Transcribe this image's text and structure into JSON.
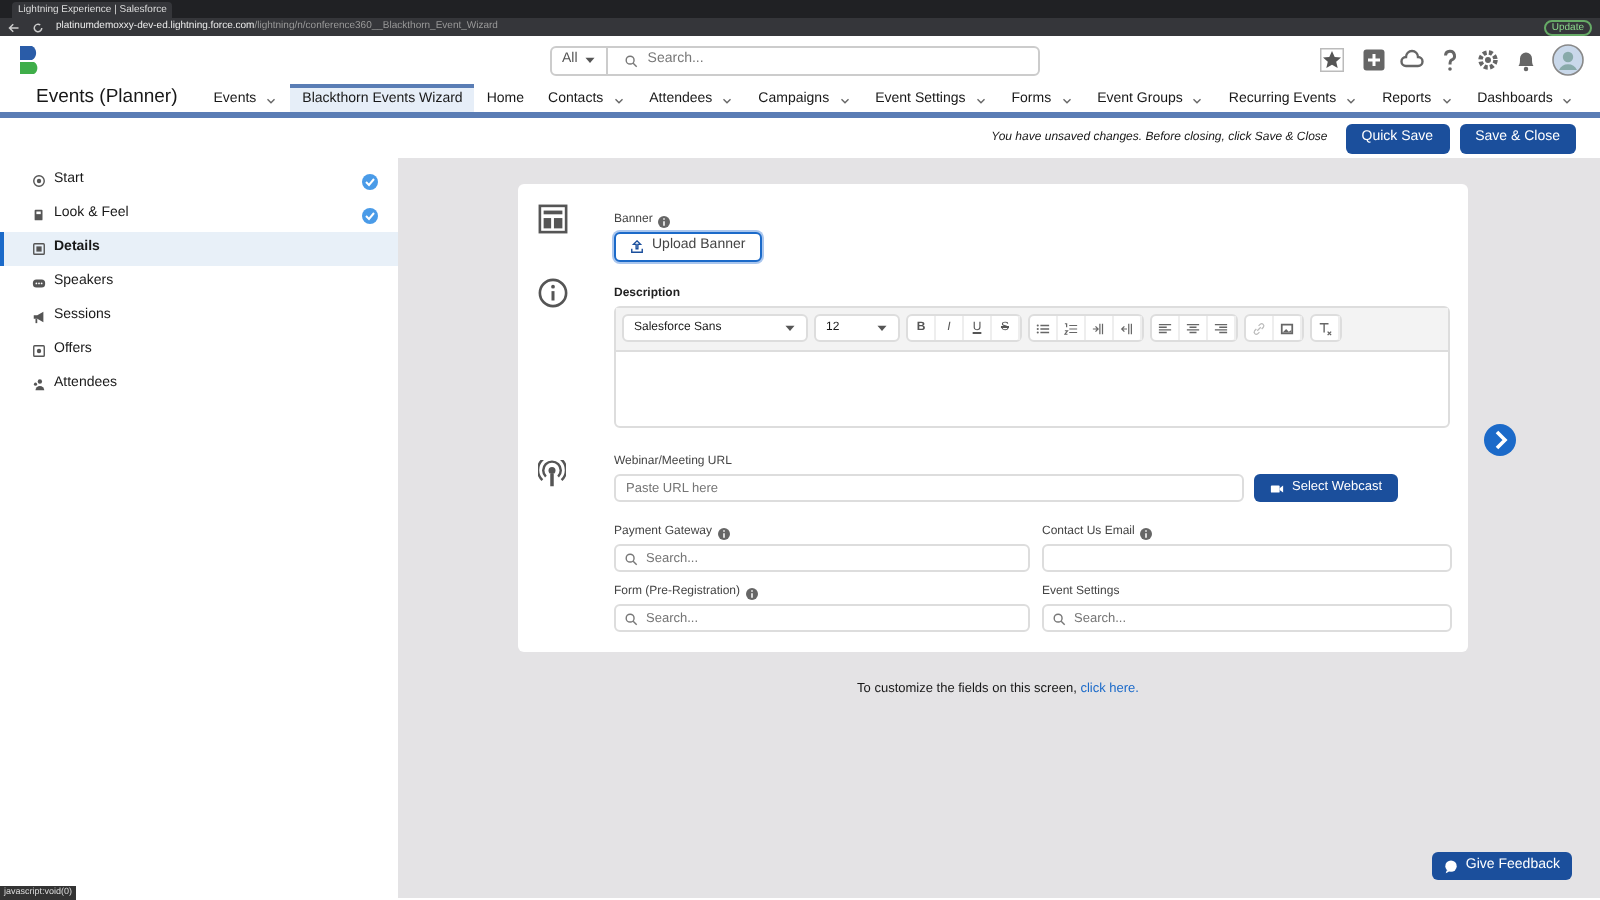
{
  "browser": {
    "tab_title": "Lightning Experience | Salesforce",
    "url_host": "platinumdemoxxy-dev-ed.lightning.force.com",
    "url_path": "/lightning/n/conference360__Blackthorn_Event_Wizard",
    "update_button": "Update",
    "status_text": "javascript:void(0)"
  },
  "header": {
    "search_scope": "All",
    "search_placeholder": "Search..."
  },
  "nav": {
    "app_name": "Events (Planner)",
    "tabs": [
      {
        "label": "Events",
        "selected": false,
        "dropdown": true
      },
      {
        "label": "Blackthorn Events Wizard",
        "selected": true,
        "dropdown": false
      },
      {
        "label": "Home",
        "selected": false,
        "dropdown": false
      },
      {
        "label": "Contacts",
        "selected": false,
        "dropdown": true
      },
      {
        "label": "Attendees",
        "selected": false,
        "dropdown": true
      },
      {
        "label": "Campaigns",
        "selected": false,
        "dropdown": true
      },
      {
        "label": "Event Settings",
        "selected": false,
        "dropdown": true
      },
      {
        "label": "Forms",
        "selected": false,
        "dropdown": true
      },
      {
        "label": "Event Groups",
        "selected": false,
        "dropdown": true
      },
      {
        "label": "Recurring Events",
        "selected": false,
        "dropdown": true
      },
      {
        "label": "Reports",
        "selected": false,
        "dropdown": true
      },
      {
        "label": "Dashboards",
        "selected": false,
        "dropdown": true
      }
    ]
  },
  "toolbar": {
    "message": "You have unsaved changes. Before closing, click Save & Close",
    "buttons": [
      "Quick Save",
      "Save & Close"
    ]
  },
  "sidebar": {
    "steps": [
      {
        "label": "Start",
        "selected": false,
        "completed": true
      },
      {
        "label": "Look & Feel",
        "selected": false,
        "completed": true
      },
      {
        "label": "Details",
        "selected": true,
        "completed": false
      },
      {
        "label": "Speakers",
        "selected": false,
        "completed": false
      },
      {
        "label": "Sessions",
        "selected": false,
        "completed": false
      },
      {
        "label": "Offers",
        "selected": false,
        "completed": false
      },
      {
        "label": "Attendees",
        "selected": false,
        "completed": false
      }
    ]
  },
  "form": {
    "banner": {
      "label": "Banner",
      "button": "Upload Banner"
    },
    "description": {
      "label": "Description",
      "font": "Salesforce Sans",
      "size": "12",
      "format_buttons": [
        "B",
        "I",
        "U",
        "S"
      ]
    },
    "webinar": {
      "label": "Webinar/Meeting URL",
      "placeholder": "Paste URL here",
      "button": "Select Webcast"
    },
    "fields": [
      {
        "label": "Payment Gateway",
        "info": true,
        "kind": "search",
        "placeholder": "Search..."
      },
      {
        "label": "Contact Us Email",
        "info": true,
        "kind": "text"
      },
      {
        "label": "Form (Pre-Registration)",
        "info": true,
        "kind": "search",
        "placeholder": "Search..."
      },
      {
        "label": "Event Settings",
        "info": false,
        "kind": "search",
        "placeholder": "Search..."
      }
    ]
  },
  "footer": {
    "text": "To customize the fields on this screen,",
    "link": "click here."
  },
  "feedback_button": "Give Feedback"
}
